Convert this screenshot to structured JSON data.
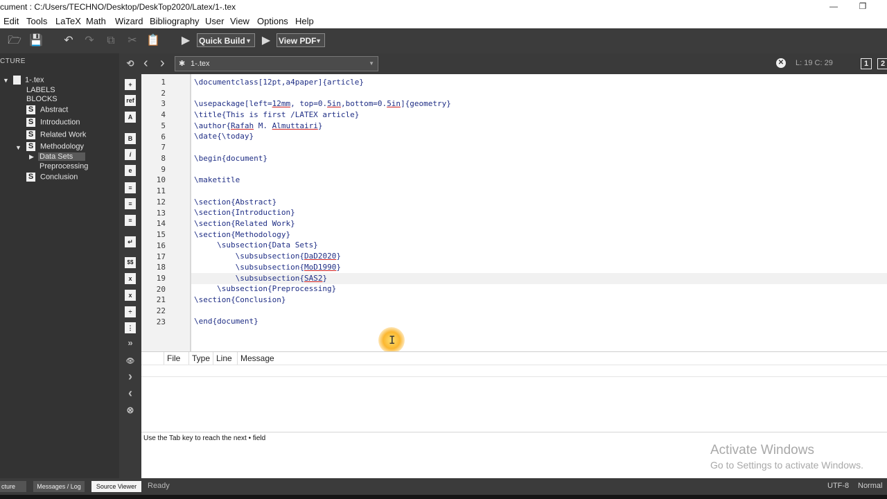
{
  "titlebar": {
    "title": "cument : C:/Users/TECHNO/Desktop/DeskTop2020/Latex/1-.tex",
    "minimize": "—",
    "restore": "❐"
  },
  "menu": [
    "Edit",
    "Tools",
    "LaTeX",
    "Math",
    "Wizard",
    "Bibliography",
    "User",
    "View",
    "Options",
    "Help"
  ],
  "toolbar": {
    "build_combo": "Quick Build",
    "view_combo": "View PDF"
  },
  "structure": {
    "header": "CTURE",
    "root": "1-.tex",
    "labels": "LABELS",
    "blocks": "BLOCKS",
    "badge": "S",
    "sections": [
      "Abstract",
      "Introduction",
      "Related Work",
      "Methodology",
      "Conclusion"
    ],
    "subsections": [
      "Data Sets",
      "Preprocessing"
    ]
  },
  "symbols": [
    "+",
    "ref",
    "A",
    "B",
    "i",
    "e",
    "≡",
    "≡",
    "≡",
    "↵",
    "$$",
    "x",
    "x",
    "÷",
    "⋮",
    "»",
    "👁",
    "›",
    "‹",
    "⊗"
  ],
  "tab": {
    "back": "‹",
    "forward": "›",
    "document": "1-.tex",
    "position": "L: 19 C: 29"
  },
  "editor": {
    "line_numbers": [
      "1",
      "2",
      "3",
      "4",
      "5",
      "6",
      "7",
      "8",
      "9",
      "10",
      "11",
      "12",
      "13",
      "14",
      "15",
      "16",
      "17",
      "18",
      "19",
      "20",
      "21",
      "22",
      "23"
    ],
    "lines": [
      "\\documentclass[12pt,a4paper]{article}",
      "",
      "\\usepackage[left=12mm, top=0.5in,bottom=0.5in]{geometry}",
      "\\title{This is first /LATEX article}",
      "\\author{Rafah M. Almuttairi}",
      "\\date{\\today}",
      "",
      "\\begin{document}",
      "",
      "\\maketitle",
      "",
      "\\section{Abstract}",
      "\\section{Introduction}",
      "\\section{Related Work}",
      "\\section{Methodology}",
      "     \\subsection{Data Sets}",
      "         \\subsubsection{DaD2020}",
      "         \\subsubsection{MoD1990}",
      "         \\subsubsection{SAS2}",
      "     \\subsection{Preprocessing}",
      "\\section{Conclusion}",
      "",
      "\\end{document}"
    ]
  },
  "messages": {
    "columns": [
      "File",
      "Type",
      "Line",
      "Message"
    ]
  },
  "log": {
    "text": "Use the Tab key to reach the next • field"
  },
  "watermark": {
    "title": "Activate Windows",
    "subtitle": "Go to Settings to activate Windows."
  },
  "statusbar": {
    "structure_tab": "cture",
    "messages_tab": "Messages / Log",
    "source_tab": "Source Viewer",
    "status": "Ready",
    "encoding": "UTF-8",
    "mode": "Normal"
  }
}
